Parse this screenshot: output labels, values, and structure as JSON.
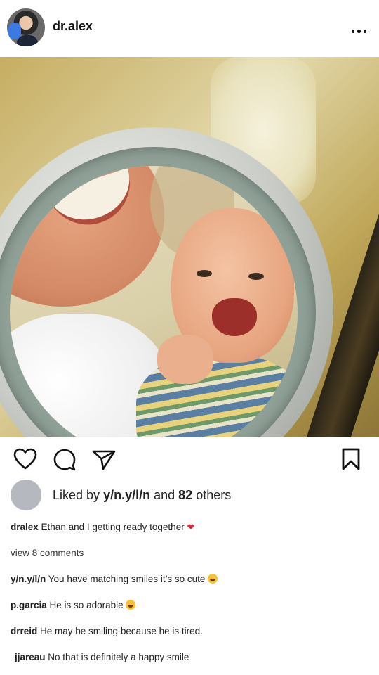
{
  "post": {
    "username": "dr.alex",
    "likes": {
      "prefix": "Liked by",
      "liker": "y/n.y/l/n",
      "and": "and",
      "count": "82",
      "suffix": "others"
    },
    "caption": {
      "user": "dralex",
      "text": "Ethan and I getting ready together",
      "emoji": "heart"
    },
    "view_comments": "view 8 comments",
    "comments": [
      {
        "user": "y/n.y/l/n",
        "text": "You have matching smiles it’s so cute",
        "emoji": "smiling-face"
      },
      {
        "user": "p.garcia",
        "text": "He is so adorable",
        "emoji": "grinning-squinting-face"
      },
      {
        "user": "drreid",
        "text": "He may be smiling because he is tired."
      },
      {
        "user": "jjareau",
        "text": "No that is definitely a happy smile"
      }
    ]
  },
  "icons": {
    "like": "heart-icon",
    "comment": "comment-icon",
    "share": "send-icon",
    "save": "bookmark-icon",
    "more": "more-icon"
  },
  "colors": {
    "text": "#111111",
    "likes_avatar": "#b6b8c0",
    "heart_emoji": "#e0243b"
  }
}
